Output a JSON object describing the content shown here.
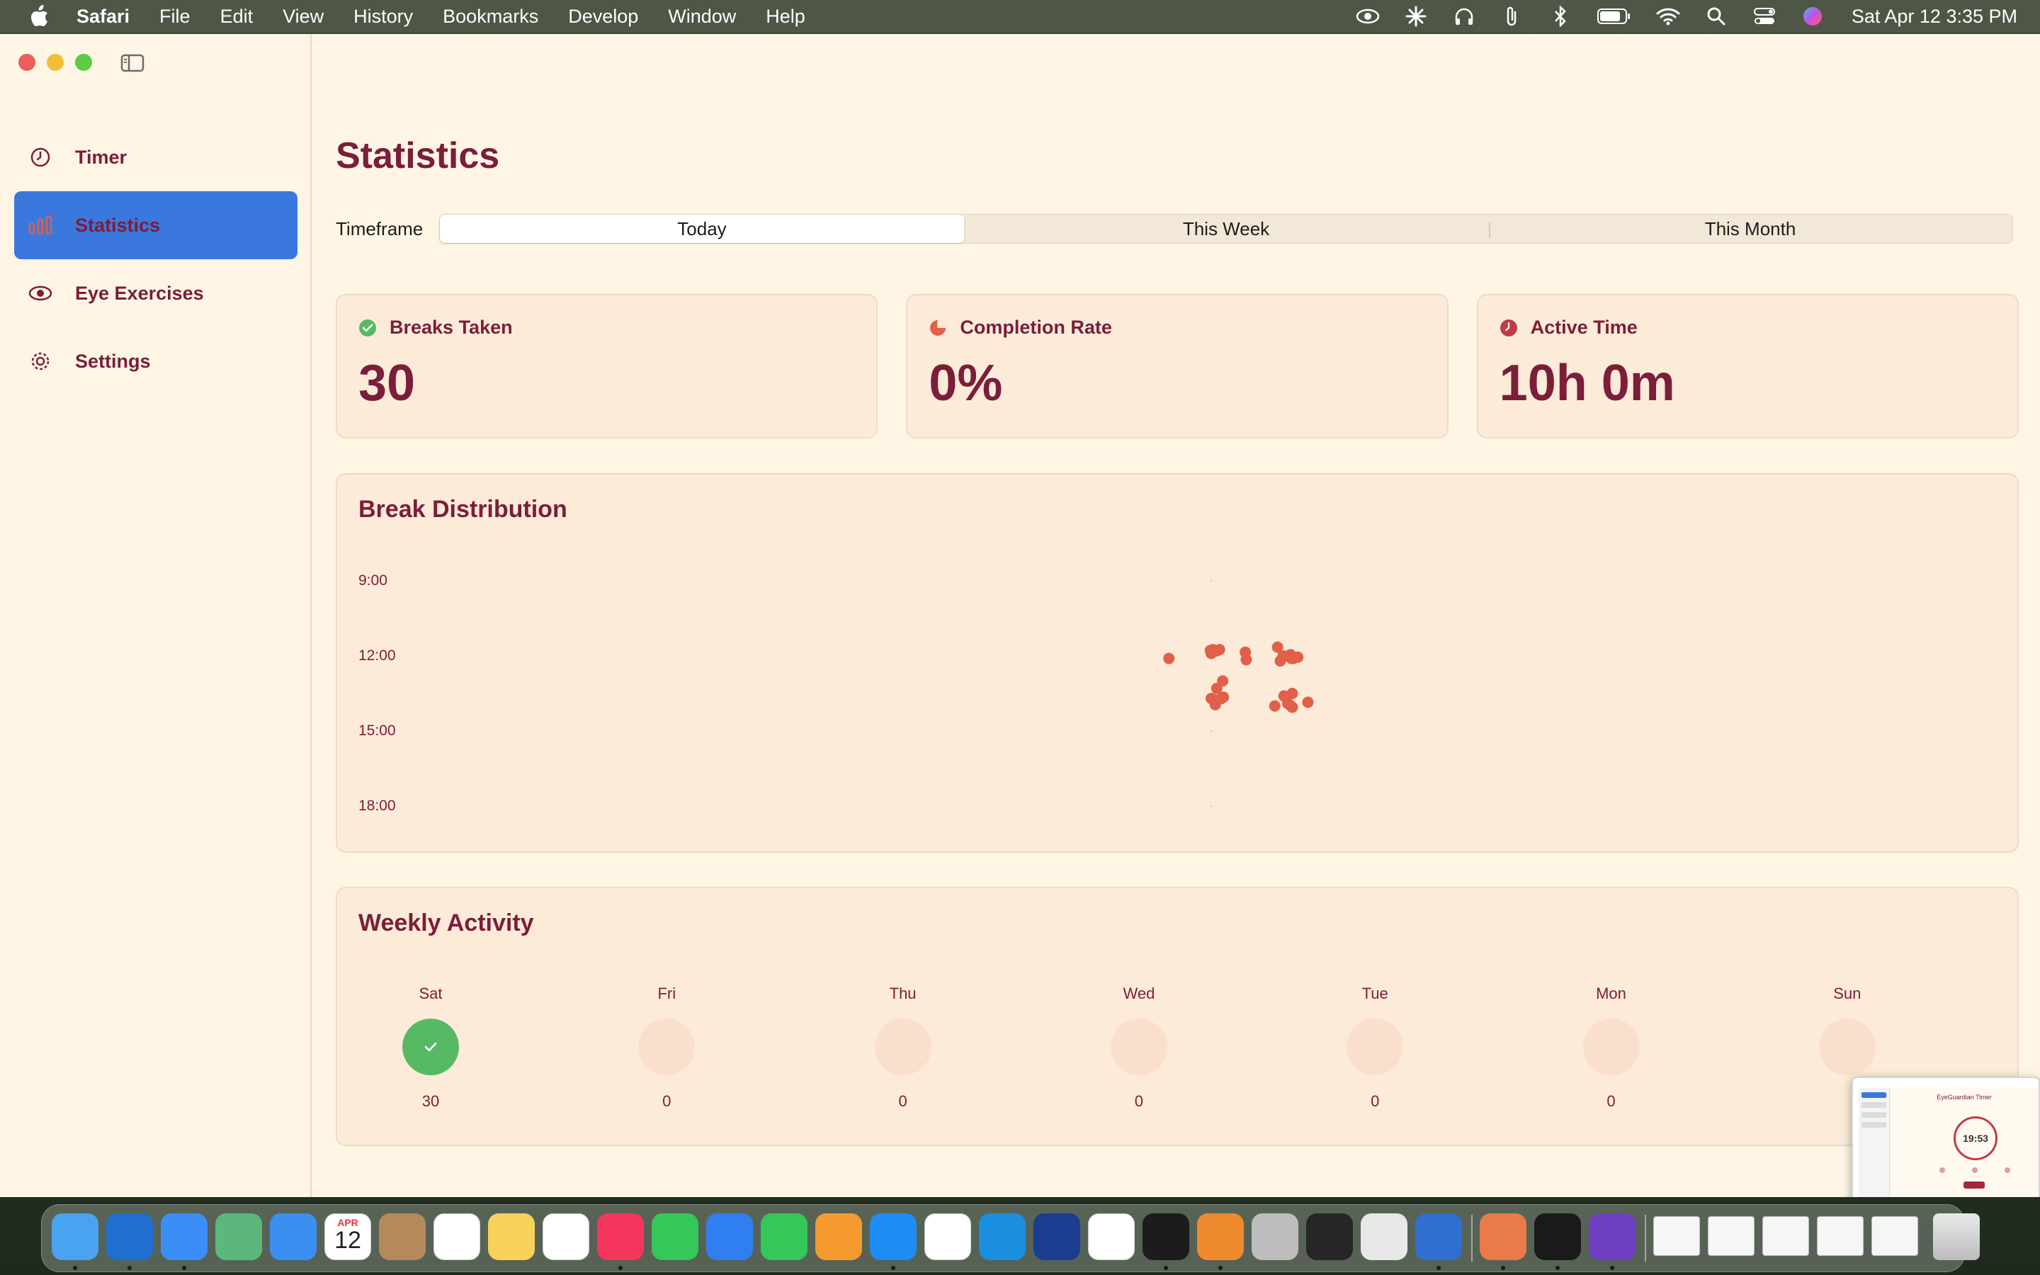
{
  "menubar": {
    "app_name": "Safari",
    "menus": [
      "File",
      "Edit",
      "View",
      "History",
      "Bookmarks",
      "Develop",
      "Window",
      "Help"
    ],
    "clock": "Sat Apr 12  3:35 PM",
    "status_icons": [
      "eye-icon",
      "asterisk-icon",
      "headphones-icon",
      "paperclip-icon",
      "bluetooth-icon",
      "battery-icon",
      "wifi-icon",
      "search-icon",
      "control-center-icon",
      "siri-icon"
    ]
  },
  "sidebar": {
    "items": [
      {
        "label": "Timer",
        "icon": "timer-icon"
      },
      {
        "label": "Statistics",
        "icon": "bar-chart-icon",
        "active": true
      },
      {
        "label": "Eye Exercises",
        "icon": "eye-icon"
      },
      {
        "label": "Settings",
        "icon": "gear-icon"
      }
    ]
  },
  "main": {
    "title": "Statistics",
    "timeframe_label": "Timeframe",
    "timeframe_options": [
      "Today",
      "This Week",
      "This Month"
    ],
    "timeframe_selected": "Today"
  },
  "cards": [
    {
      "title": "Breaks Taken",
      "value": "30",
      "icon": "checkmark-circle-icon",
      "icon_color": "#58b965"
    },
    {
      "title": "Completion Rate",
      "value": "0%",
      "icon": "pie-chart-icon",
      "icon_color": "#e0604a"
    },
    {
      "title": "Active Time",
      "value": "10h 0m",
      "icon": "clock-icon",
      "icon_color": "#c03b46"
    }
  ],
  "break_distribution": {
    "title": "Break Distribution",
    "y_labels": [
      "9:00",
      "12:00",
      "15:00",
      "18:00"
    ]
  },
  "chart_data": {
    "type": "scatter",
    "title": "Break Distribution",
    "ylabel": "",
    "y_ticks": [
      "9:00",
      "12:00",
      "15:00",
      "18:00"
    ],
    "ylim": [
      9,
      18
    ],
    "point_color": "#e0604a",
    "points": [
      {
        "x": -2.3,
        "y": 12.1
      },
      {
        "x": -0.05,
        "y": 11.78
      },
      {
        "x": 0.1,
        "y": 11.75
      },
      {
        "x": 0.28,
        "y": 11.8
      },
      {
        "x": 0.45,
        "y": 11.75
      },
      {
        "x": 0.0,
        "y": 11.9
      },
      {
        "x": 0.62,
        "y": 13.0
      },
      {
        "x": 0.3,
        "y": 13.3
      },
      {
        "x": 0.0,
        "y": 13.7
      },
      {
        "x": 0.22,
        "y": 13.95
      },
      {
        "x": 0.55,
        "y": 13.7
      },
      {
        "x": 0.66,
        "y": 13.65
      },
      {
        "x": 1.85,
        "y": 11.85
      },
      {
        "x": 1.9,
        "y": 12.15
      },
      {
        "x": 3.6,
        "y": 11.65
      },
      {
        "x": 3.9,
        "y": 12.0
      },
      {
        "x": 3.75,
        "y": 12.2
      },
      {
        "x": 4.3,
        "y": 11.95
      },
      {
        "x": 4.45,
        "y": 12.1
      },
      {
        "x": 4.7,
        "y": 12.05
      },
      {
        "x": 3.45,
        "y": 14.0
      },
      {
        "x": 3.95,
        "y": 13.6
      },
      {
        "x": 4.4,
        "y": 13.5
      },
      {
        "x": 4.25,
        "y": 13.95
      },
      {
        "x": 4.4,
        "y": 14.05
      },
      {
        "x": 5.25,
        "y": 13.85
      },
      {
        "x": 4.15,
        "y": 13.9
      },
      {
        "x": 0.15,
        "y": 13.75
      },
      {
        "x": 3.9,
        "y": 12.05
      },
      {
        "x": 4.35,
        "y": 12.1
      }
    ]
  },
  "weekly_activity": {
    "title": "Weekly Activity",
    "days": [
      {
        "name": "Sat",
        "count": "30",
        "done": true
      },
      {
        "name": "Fri",
        "count": "0",
        "done": false
      },
      {
        "name": "Thu",
        "count": "0",
        "done": false
      },
      {
        "name": "Wed",
        "count": "0",
        "done": false
      },
      {
        "name": "Tue",
        "count": "0",
        "done": false
      },
      {
        "name": "Mon",
        "count": "0",
        "done": false
      },
      {
        "name": "Sun",
        "count": "",
        "done": false
      }
    ]
  },
  "thumbnail": {
    "title": "EyeGuardian Timer",
    "time": "19:53"
  },
  "dock": {
    "calendar_month": "APR",
    "calendar_day": "12",
    "apps": [
      "finder-icon",
      "outlook-icon",
      "safari-icon",
      "maps-icon",
      "mail-icon",
      "calendar-icon",
      "contacts-icon",
      "reminders-icon",
      "notes-icon",
      "freeform-icon",
      "music-icon",
      "messages-icon",
      "keynote-icon",
      "numbers-icon",
      "pages-icon",
      "app-store-icon",
      "slack-icon",
      "skype-icon",
      "pinpoint-icon",
      "chrome-icon",
      "stocks-icon",
      "vpn-icon",
      "launchpad-icon",
      "record-icon",
      "simulator-icon",
      "xcode-icon",
      "claude-icon",
      "terminal-icon",
      "github-icon"
    ]
  }
}
